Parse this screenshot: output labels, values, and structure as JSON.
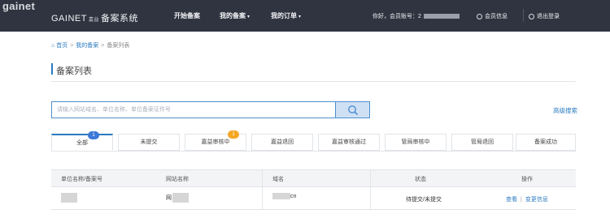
{
  "watermark": "gainet",
  "header": {
    "logo_brand": "GAINET",
    "logo_small": "嘉益",
    "logo_title": "备案系统",
    "nav": [
      {
        "label": "开始备案",
        "has_caret": false
      },
      {
        "label": "我的备案",
        "has_caret": true
      },
      {
        "label": "我的订单",
        "has_caret": true
      }
    ],
    "user_greeting": "你好，会员账号：2",
    "account_center": "会员信息",
    "logout": "退出登录"
  },
  "breadcrumb": {
    "home": "首页",
    "parent": "我的备案",
    "current": "备案列表",
    "separator": ">"
  },
  "page": {
    "title": "备案列表"
  },
  "search": {
    "placeholder": "请输入网站域名、单位名称、单位备案证件号",
    "value": "",
    "advanced_link": "高级搜索"
  },
  "tabs": [
    {
      "label": "全部",
      "badge": "1",
      "badge_color": "#3d78d8",
      "active": true
    },
    {
      "label": "未提交",
      "badge": "",
      "active": false
    },
    {
      "label": "嘉益审核中",
      "badge": "1",
      "badge_color": "#f5a623",
      "active": false
    },
    {
      "label": "嘉益退回",
      "badge": "",
      "active": false
    },
    {
      "label": "嘉益审核通过",
      "badge": "",
      "active": false
    },
    {
      "label": "管局审核中",
      "badge": "",
      "active": false
    },
    {
      "label": "管局退回",
      "badge": "",
      "active": false
    },
    {
      "label": "备案成功",
      "badge": "",
      "active": false
    }
  ],
  "table": {
    "columns": [
      "单位名称/备案号",
      "网站名称",
      "域名",
      "状态",
      "操作"
    ],
    "rows": [
      {
        "unit": "",
        "site_name": "网",
        "domain": "cn",
        "status": "待提交/未提交",
        "action_view": "查看",
        "action_modify": "变更信息"
      }
    ]
  },
  "colors": {
    "topbar": "#2f3440",
    "accent": "#2b7bc1",
    "badge_orange": "#f5a623",
    "badge_blue": "#3d78d8"
  }
}
